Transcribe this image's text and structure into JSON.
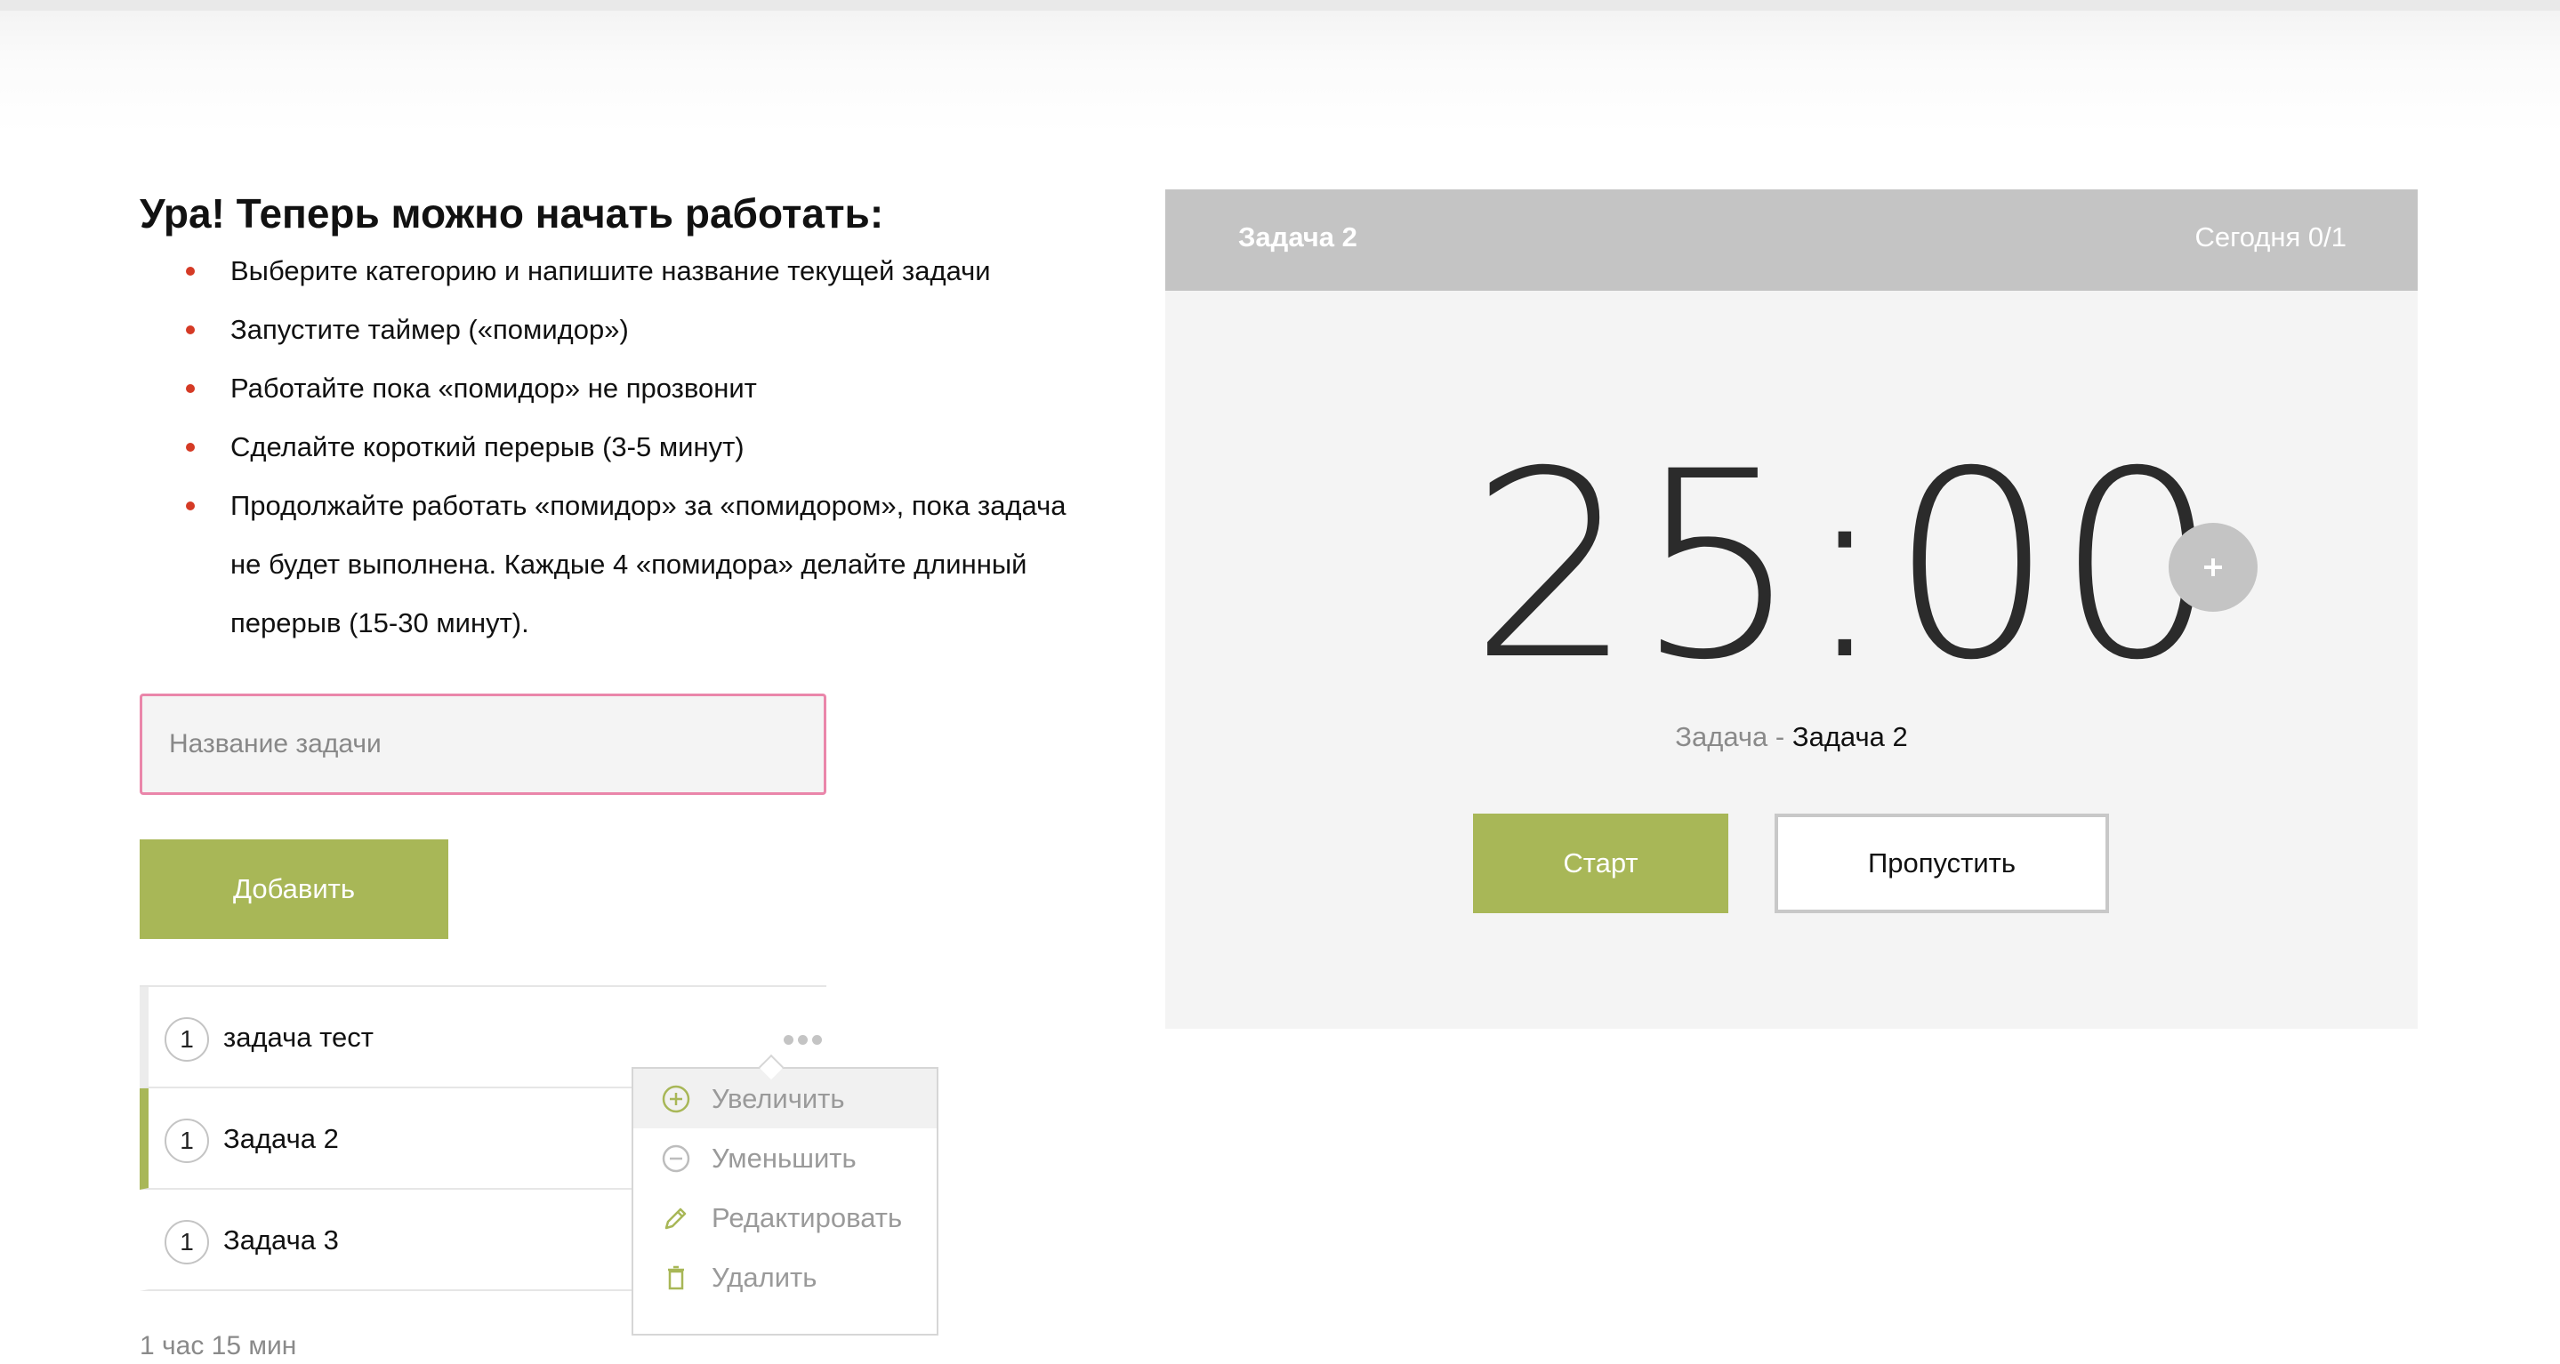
{
  "instructions": {
    "title": "Ура! Теперь можно начать работать:",
    "steps": [
      "Выберите категорию и напишите название текущей задачи",
      "Запустите таймер («помидор»)",
      "Работайте пока «помидор» не прозвонит",
      "Сделайте короткий перерыв (3-5 минут)",
      "Продолжайте работать «помидор» за «помидором», пока задача",
      "не будет выполнена. Каждые 4 «помидора» делайте длинный",
      "перерыв (15-30 минут)."
    ]
  },
  "task_form": {
    "input_value": "",
    "input_placeholder": "Название задачи",
    "add_label": "Добавить"
  },
  "tasks": [
    {
      "count": "1",
      "name": "задача тест"
    },
    {
      "count": "1",
      "name": "Задача 2"
    },
    {
      "count": "1",
      "name": "Задача 3"
    }
  ],
  "total_time": "1 час 15 мин",
  "menu": {
    "items": [
      {
        "label": "Увеличить",
        "icon": "plus-circle-icon"
      },
      {
        "label": "Уменьшить",
        "icon": "minus-circle-icon"
      },
      {
        "label": "Редактировать",
        "icon": "pencil-icon"
      },
      {
        "label": "Удалить",
        "icon": "trash-icon"
      }
    ]
  },
  "timer": {
    "header_task": "Задача 2",
    "header_today": "Сегодня 0/1",
    "time": "25:00",
    "task_prefix": "Задача -",
    "task_name": "Задача 2",
    "start_label": "Старт",
    "skip_label": "Пропустить"
  },
  "colors": {
    "accent": "#a8b757",
    "bullet": "#d53a25",
    "input_border": "#ea86aa",
    "header_gray": "#c4c4c4",
    "panel_bg": "#f4f4f4"
  }
}
